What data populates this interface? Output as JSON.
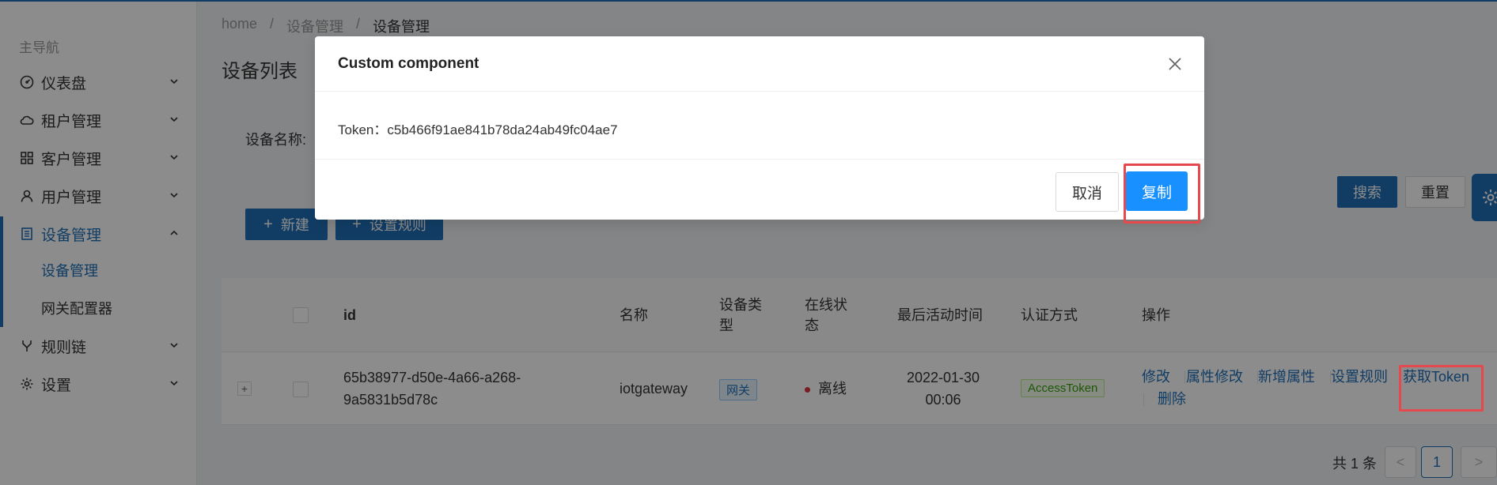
{
  "sidebar": {
    "title": "主导航",
    "items": [
      {
        "label": "仪表盘"
      },
      {
        "label": "租户管理"
      },
      {
        "label": "客户管理"
      },
      {
        "label": "用户管理"
      },
      {
        "label": "设备管理"
      },
      {
        "label": "规则链"
      },
      {
        "label": "设置"
      }
    ],
    "sub_items": [
      {
        "label": "设备管理"
      },
      {
        "label": "网关配置器"
      }
    ]
  },
  "breadcrumb": {
    "items": [
      "home",
      "设备管理",
      "设备管理"
    ],
    "separator": "/"
  },
  "page": {
    "title": "设备列表",
    "filter_label": "设备名称:",
    "new_button": "新建",
    "rule_button": "设置规则",
    "search_button": "搜索",
    "reset_button": "重置"
  },
  "table": {
    "headers": [
      "id",
      "名称",
      "设备类型",
      "在线状态",
      "最后活动时间",
      "认证方式",
      "操作"
    ],
    "rows": [
      {
        "id_line1": "65b38977-d50e-4a66-a268-",
        "id_line2": "9a5831b5d78c",
        "name": "iotgateway",
        "type": "网关",
        "status": "离线",
        "last_active_date": "2022-01-30",
        "last_active_time": "00:06",
        "auth": "AccessToken",
        "actions": [
          "修改",
          "属性修改",
          "新增属性",
          "设置规则",
          "获取Token",
          "删除"
        ]
      }
    ]
  },
  "pagination": {
    "total_text": "共 1 条",
    "current_page": "1",
    "prev": "<",
    "next": ">"
  },
  "modal": {
    "title": "Custom component",
    "body": "Token：c5b466f91ae841b78da24ab49fc04ae7",
    "cancel_label": "取消",
    "copy_label": "复制"
  },
  "colors": {
    "primary": "#1f6fb8",
    "modal_primary": "#1890ff",
    "highlight": "#e5484d",
    "offline": "#d9363e"
  }
}
